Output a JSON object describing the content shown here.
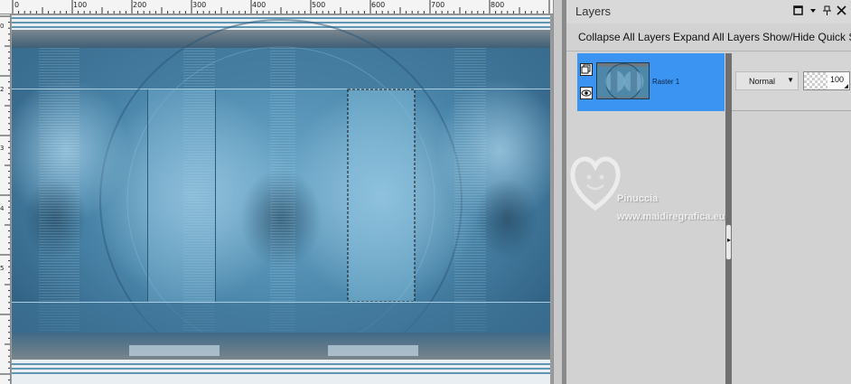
{
  "ruler": {
    "top_labels": [
      "0",
      "100",
      "200",
      "300",
      "400",
      "500",
      "600",
      "700",
      "800"
    ],
    "left_labels": [
      "0",
      "2",
      "3",
      "4",
      "5"
    ]
  },
  "canvas": {
    "selection": "rectangular-marquee",
    "colors": {
      "base": "#4f87a8",
      "dark": "#2d5878",
      "light": "#8ec0dc",
      "gray": "#6f7880"
    }
  },
  "layers_panel": {
    "title": "Layers",
    "header_icons": [
      "restore-icon",
      "dropdown-icon",
      "pin-icon",
      "close-icon"
    ],
    "toolbar": {
      "collapse_all": "Collapse All Layers",
      "expand_all": "Expand All Layers",
      "show_hide_quick": "Show/Hide Quick S"
    },
    "layer": {
      "name": "Raster 1",
      "selected": true,
      "icons": [
        "layer-type-icon",
        "visibility-eye-icon"
      ]
    },
    "blend_mode": "Normal",
    "opacity": "100",
    "colors": {
      "selection": "#3b94f2",
      "panel": "#d2d2d2"
    }
  },
  "watermark": {
    "line1": "Pinuccia",
    "line2": "www.maidiregrafica.eu"
  }
}
